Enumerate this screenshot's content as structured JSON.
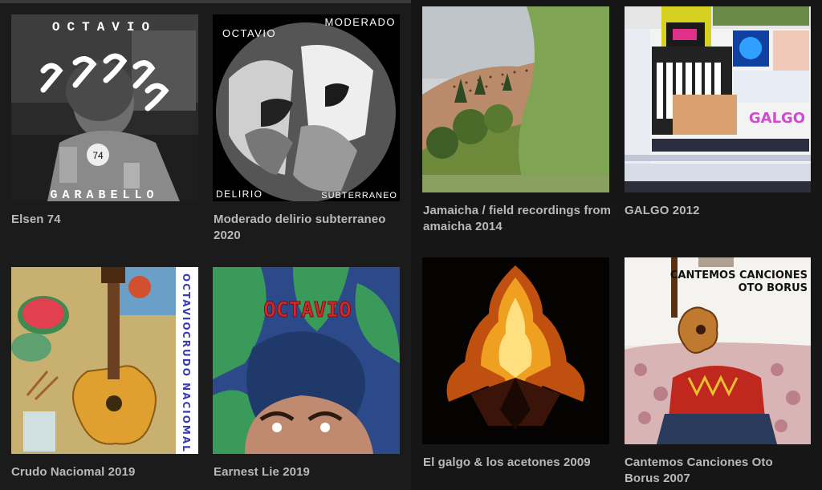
{
  "albums": [
    {
      "title": "Elsen 74",
      "cover": {
        "top_text": "OCTAVIO",
        "bottom_text": "GARABELLO",
        "badge": "74"
      }
    },
    {
      "title": "Moderado delirio subterraneo 2020",
      "cover": {
        "tl": "OCTAVIO",
        "tr": "MODERADO",
        "bl": "DELIRIO",
        "br": "SUBTERRANEO"
      }
    },
    {
      "title": "Jamaicha / field recordings from amaicha 2014"
    },
    {
      "title": "GALGO 2012",
      "cover": {
        "word": "GALGO"
      }
    },
    {
      "title": "Crudo Naciomal 2019",
      "cover": {
        "side_text_1": "OCTAVIO",
        "side_text_2": "CRUDO NACIOMAL"
      }
    },
    {
      "title": "Earnest Lie 2019",
      "cover": {
        "word": "OCTAVIO"
      }
    },
    {
      "title": "El galgo & los acetones 2009"
    },
    {
      "title": "Cantemos Canciones Oto Borus 2007",
      "cover": {
        "line1": "CANTEMOS CANCIONES",
        "line2": "OTO BORUS"
      }
    }
  ],
  "colors": {
    "background": "#1a1a1a",
    "caption": "#b9b9b9"
  }
}
